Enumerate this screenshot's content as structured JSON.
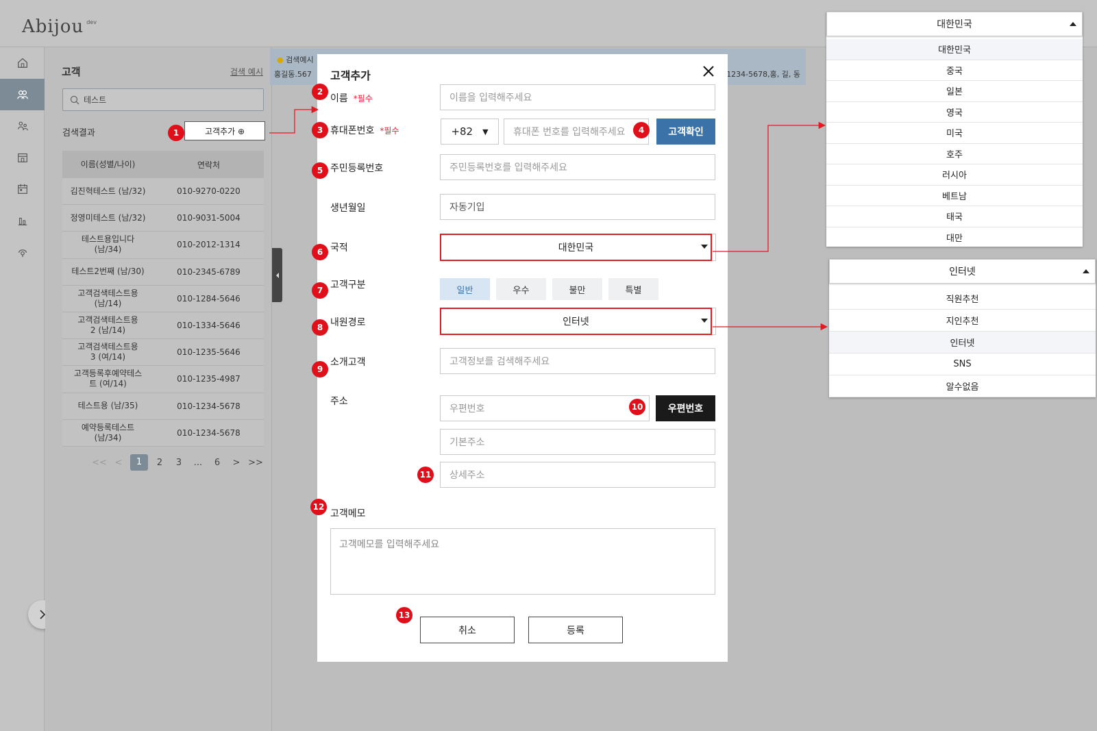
{
  "app": {
    "logo": "Abijou",
    "env": "dev"
  },
  "panel": {
    "title": "고객",
    "example_link": "검색 예시",
    "search_value": "테스트",
    "result_label": "검색결과",
    "add_button": "고객추가 ⊕",
    "columns": [
      "이름(성별/나이)",
      "연락처"
    ],
    "rows": [
      {
        "name": "김진혁테스트 (남/32)",
        "phone": "010-9270-0220"
      },
      {
        "name": "정영미테스트 (남/32)",
        "phone": "010-9031-5004"
      },
      {
        "name": "테스트용입니다 (남/34)",
        "phone": "010-2012-1314"
      },
      {
        "name": "테스트2번째 (남/30)",
        "phone": "010-2345-6789"
      },
      {
        "name": "고객검색테스트용 (남/14)",
        "phone": "010-1284-5646"
      },
      {
        "name": "고객검색테스트용 2 (남/14)",
        "phone": "010-1334-5646"
      },
      {
        "name": "고객검색테스트용 3 (여/14)",
        "phone": "010-1235-5646"
      },
      {
        "name": "고객등록후예약테스트 (여/14)",
        "phone": "010-1235-4987"
      },
      {
        "name": "테스트용 (남/35)",
        "phone": "010-1234-5678"
      },
      {
        "name": "예약등록테스트 (남/34)",
        "phone": "010-1234-5678"
      }
    ],
    "pager": {
      "first": "<<",
      "prev": "<",
      "pages": [
        "1",
        "2",
        "3",
        "...",
        "6"
      ],
      "next": ">",
      "last": ">>",
      "current": "1"
    }
  },
  "hint": {
    "line1": "검색예시",
    "line2": "홍길동.567",
    "line3": "1234-5678,홍, 길, 동"
  },
  "modal": {
    "title": "고객추가",
    "required_mark": "*필수",
    "name_label": "이름",
    "name_placeholder": "이름을 입력해주세요",
    "phone_label": "휴대폰번호",
    "country_code": "+82",
    "phone_placeholder": "휴대폰 번호를 입력해주세요",
    "check_button": "고객확인",
    "ssn_label": "주민등록번호",
    "ssn_placeholder": "주민등록번호를 입력해주세요",
    "birth_label": "생년월일",
    "birth_value": "자동기입",
    "nation_label": "국적",
    "nation_value": "대한민국",
    "type_label": "고객구분",
    "types": [
      "일반",
      "우수",
      "불만",
      "특별"
    ],
    "source_label": "내원경로",
    "source_value": "인터넷",
    "referrer_label": "소개고객",
    "referrer_placeholder": "고객정보를 검색해주세요",
    "address_label": "주소",
    "zip_placeholder": "우편번호",
    "zip_button": "우편번호",
    "addr1_placeholder": "기본주소",
    "addr2_placeholder": "상세주소",
    "memo_label": "고객메모",
    "memo_placeholder": "고객메모를 입력해주세요",
    "cancel": "취소",
    "submit": "등록"
  },
  "badges": [
    "1",
    "2",
    "3",
    "4",
    "5",
    "6",
    "7",
    "8",
    "9",
    "10",
    "11",
    "12",
    "13"
  ],
  "nation_dropdown": {
    "selected": "대한민국",
    "options": [
      "대한민국",
      "중국",
      "일본",
      "영국",
      "미국",
      "호주",
      "러시아",
      "베트남",
      "태국",
      "대만"
    ]
  },
  "source_dropdown": {
    "selected": "인터넷",
    "options": [
      "직원추천",
      "지인추천",
      "인터넷",
      "SNS",
      "알수없음"
    ]
  },
  "colors": {
    "accent": "#3b73a8",
    "badge": "#e0101b",
    "highlight_border": "#e11b22",
    "sidebar_active": "#7d8b97"
  }
}
